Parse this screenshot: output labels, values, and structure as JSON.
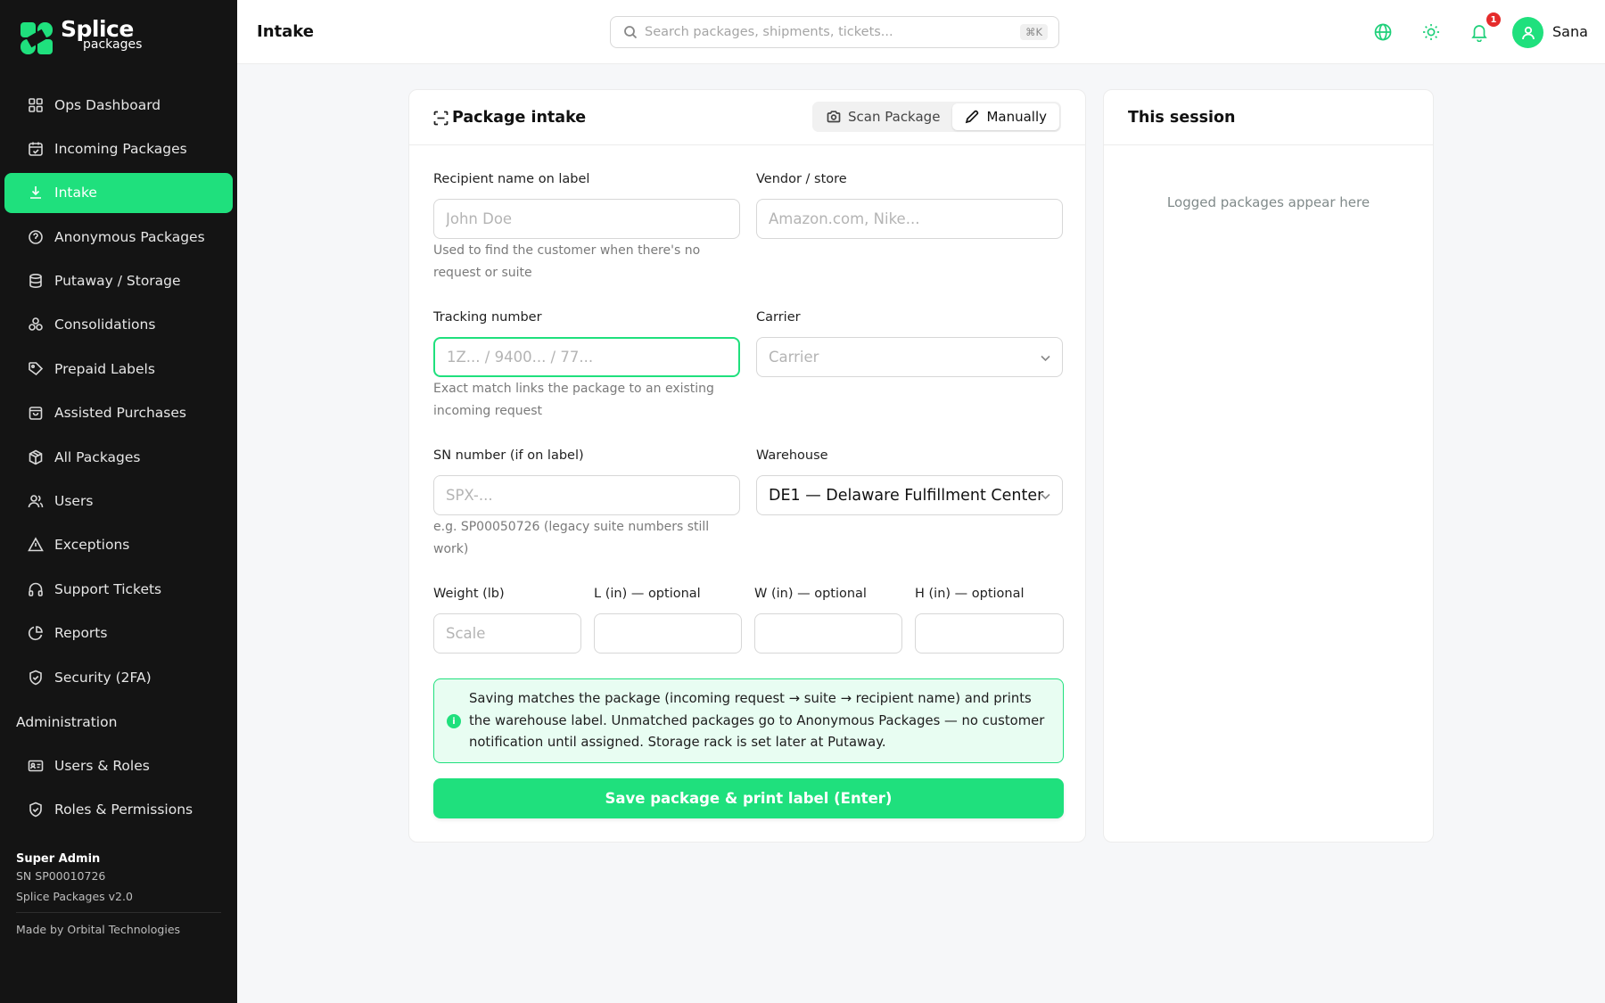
{
  "brand": {
    "name": "Splice",
    "sub": "packages",
    "accent": "#1fe07d",
    "dark": "#141414"
  },
  "sidebar": {
    "items": [
      {
        "label": "Ops Dashboard",
        "icon": "grid-icon"
      },
      {
        "label": "Incoming Packages",
        "icon": "calendar-icon"
      },
      {
        "label": "Intake",
        "icon": "download-icon",
        "active": true
      },
      {
        "label": "Anonymous Packages",
        "icon": "question-circle-icon"
      },
      {
        "label": "Putaway / Storage",
        "icon": "database-icon"
      },
      {
        "label": "Consolidations",
        "icon": "boxes-icon"
      },
      {
        "label": "Prepaid Labels",
        "icon": "tag-icon"
      },
      {
        "label": "Assisted Purchases",
        "icon": "shopping-bag-icon"
      },
      {
        "label": "All Packages",
        "icon": "package-icon"
      },
      {
        "label": "Users",
        "icon": "users-icon"
      },
      {
        "label": "Exceptions",
        "icon": "alert-triangle-icon"
      },
      {
        "label": "Support Tickets",
        "icon": "headphones-icon"
      },
      {
        "label": "Reports",
        "icon": "pie-chart-icon"
      },
      {
        "label": "Security (2FA)",
        "icon": "shield-check-icon"
      }
    ],
    "admin_section": "Administration",
    "admin_items": [
      {
        "label": "Users & Roles",
        "icon": "id-card-icon"
      },
      {
        "label": "Roles & Permissions",
        "icon": "shield-icon"
      }
    ],
    "footer": {
      "role": "Super Admin",
      "sn": "SN SP00010726",
      "version": "Splice Packages v2.0",
      "made_by": "Made by Orbital Technologies"
    }
  },
  "topbar": {
    "title": "Intake",
    "search_placeholder": "Search packages, shipments, tickets...",
    "shortcut": "⌘K",
    "notification_count": "1",
    "user_name": "Sana"
  },
  "intake": {
    "title": "Package intake",
    "mode_scan": "Scan Package",
    "mode_manual": "Manually",
    "recipient": {
      "label": "Recipient name on label",
      "placeholder": "John Doe",
      "help": "Used to find the customer when there's no request or suite"
    },
    "vendor": {
      "label": "Vendor / store",
      "placeholder": "Amazon.com, Nike..."
    },
    "tracking": {
      "label": "Tracking number",
      "placeholder": "1Z... / 9400... / 77...",
      "help": "Exact match links the package to an existing incoming request"
    },
    "carrier": {
      "label": "Carrier",
      "placeholder": "Carrier"
    },
    "sn": {
      "label": "SN number (if on label)",
      "placeholder": "SPX-...",
      "help": "e.g. SP00050726 (legacy suite numbers still work)"
    },
    "warehouse": {
      "label": "Warehouse",
      "value": "DE1 — Delaware Fulfillment Center"
    },
    "weight": {
      "label": "Weight (lb)",
      "placeholder": "Scale"
    },
    "length": {
      "label": "L (in) — optional"
    },
    "width": {
      "label": "W (in) — optional"
    },
    "height": {
      "label": "H (in) — optional"
    },
    "info": "Saving matches the package (incoming request → suite → recipient name) and prints the warehouse label. Unmatched packages go to Anonymous Packages — no customer notification until assigned. Storage rack is set later at Putaway.",
    "save_label": "Save package & print label (Enter)"
  },
  "session": {
    "title": "This session",
    "empty": "Logged packages appear here"
  }
}
